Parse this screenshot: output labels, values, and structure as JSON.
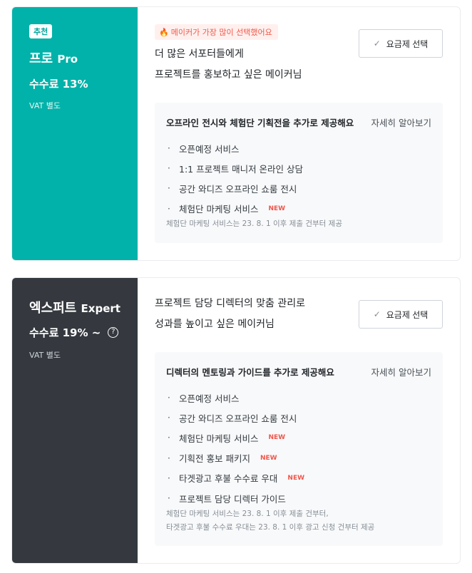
{
  "plans": [
    {
      "badge": "추천",
      "name_ko": "프로",
      "name_en": "Pro",
      "fee": "수수료 13%",
      "vat": "VAT 별도",
      "hot_badge": "메이커가 가장 많이 선택했어요",
      "desc_line1": "더 많은 서포터들에게",
      "desc_line2": "프로젝트를 홍보하고 싶은 메이커님",
      "select_label": "요금제 선택",
      "box_title": "오프라인 전시와 체험단 기획전을 추가로 제공해요",
      "more_label": "자세히 알아보기",
      "benefits": [
        {
          "text": "오픈예정 서비스",
          "new": ""
        },
        {
          "text": "1:1 프로젝트 매니저 온라인 상담",
          "new": ""
        },
        {
          "text": "공간 와디즈 오프라인 쇼룸 전시",
          "new": ""
        },
        {
          "text": "체험단 마케팅 서비스",
          "new": "NEW"
        }
      ],
      "footnote_line1": "체험단 마케팅 서비스는 23. 8. 1 이후 제출 건부터 제공",
      "accent": "#00b2a9"
    },
    {
      "name_ko": "엑스퍼트",
      "name_en": "Expert",
      "fee": "수수료 19% ~",
      "vat": "VAT 별도",
      "desc_line1": "프로젝트 담당 디렉터의 맞춤 관리로",
      "desc_line2": "성과를 높이고 싶은 메이커님",
      "select_label": "요금제 선택",
      "box_title": "디렉터의 멘토링과 가이드를 추가로 제공해요",
      "more_label": "자세히 알아보기",
      "benefits": [
        {
          "text": "오픈예정 서비스",
          "new": ""
        },
        {
          "text": "공간 와디즈 오프라인 쇼룸 전시",
          "new": ""
        },
        {
          "text": "체험단 마케팅 서비스",
          "new": "NEW"
        },
        {
          "text": "기획전 홍보 패키지",
          "new": "NEW"
        },
        {
          "text": "타겟광고 후불 수수료 우대",
          "new": "NEW"
        },
        {
          "text": "프로젝트 담당 디렉터 가이드",
          "new": ""
        }
      ],
      "footnote_line1": "체험단 마케팅 서비스는 23. 8. 1 이후 제출 건부터,",
      "footnote_line2": "타겟광고 후불 수수료 우대는 23. 8. 1 이후 광고 신청 건부터 제공",
      "accent": "#35393f"
    }
  ],
  "icons": {
    "check": "check-icon",
    "fire": "fire-icon",
    "help": "help-circle-icon",
    "bullet": "bullet-dot-icon"
  }
}
